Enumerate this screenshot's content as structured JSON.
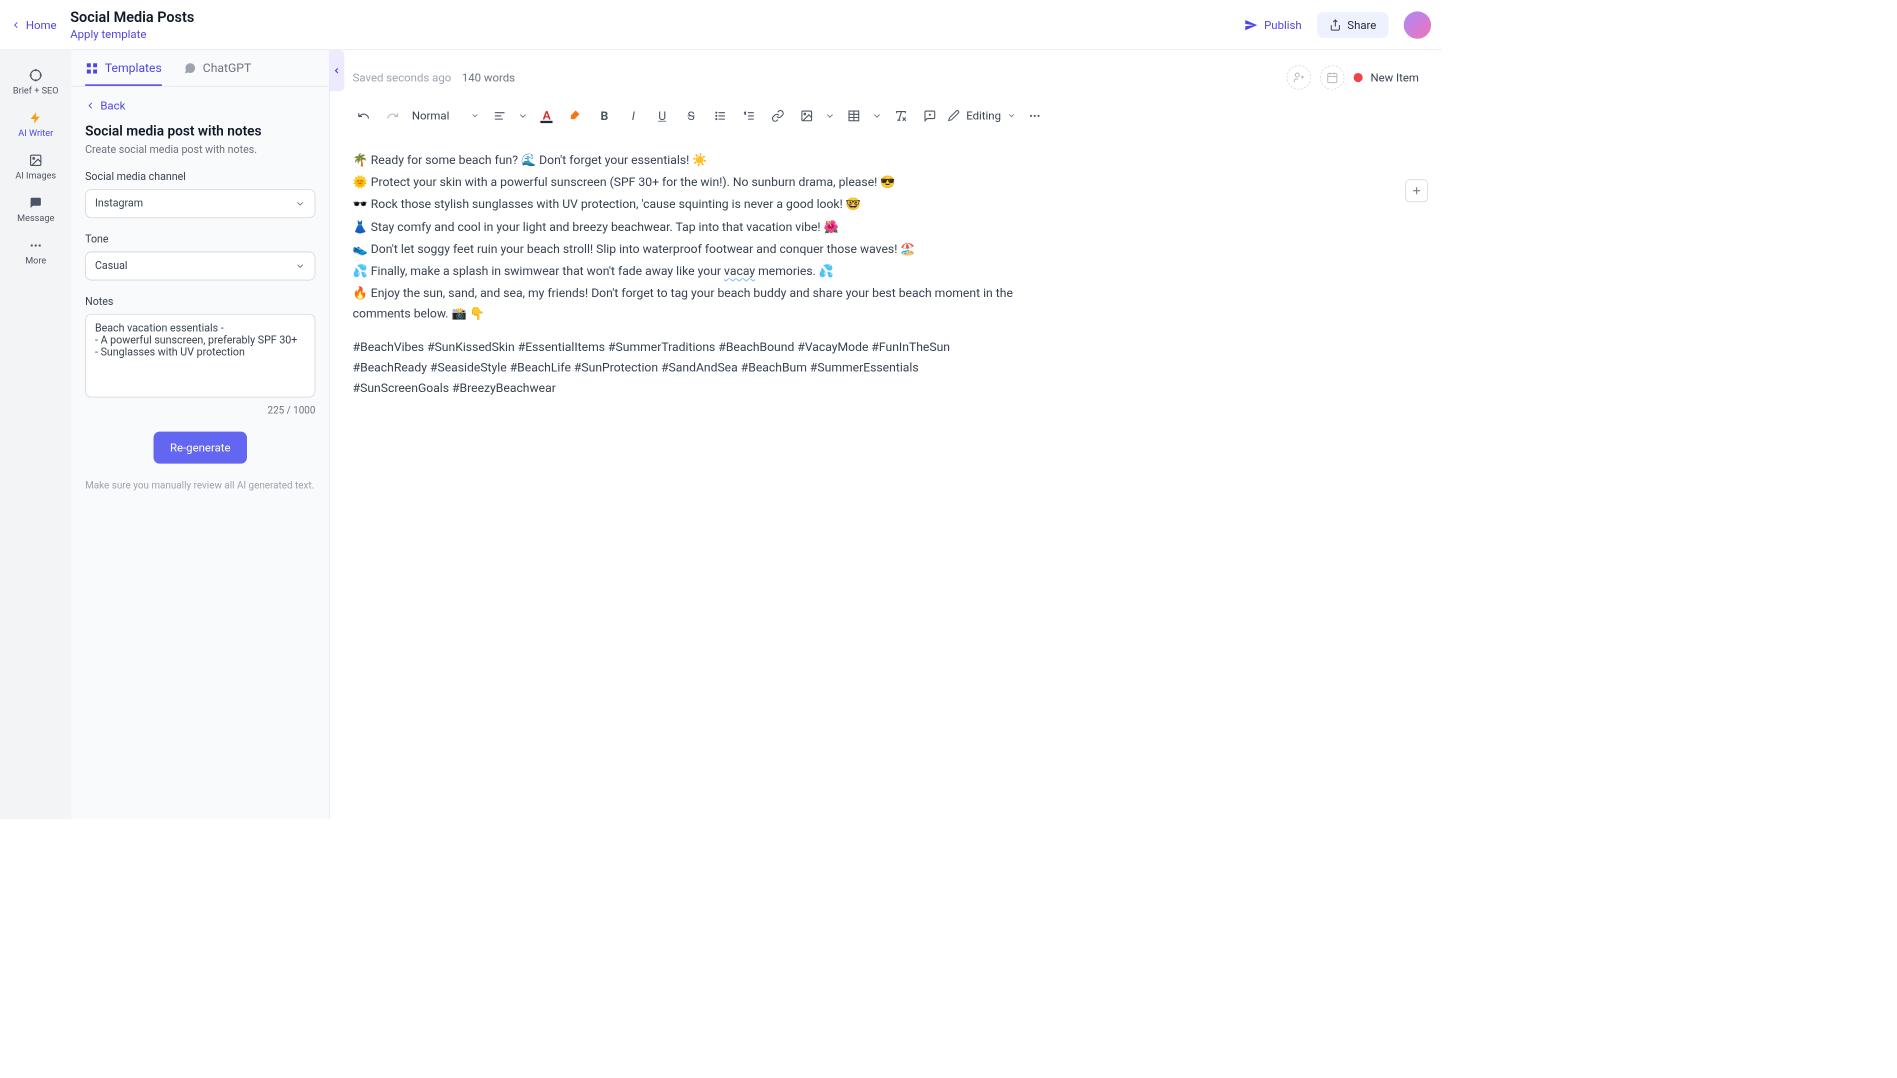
{
  "topbar": {
    "home": "Home",
    "title": "Social Media Posts",
    "apply_template": "Apply template",
    "publish": "Publish",
    "share": "Share"
  },
  "rail": {
    "items": [
      "Brief + SEO",
      "AI Writer",
      "AI Images",
      "Message",
      "More"
    ]
  },
  "tabs": {
    "templates": "Templates",
    "chatgpt": "ChatGPT"
  },
  "panel": {
    "back": "Back",
    "title": "Social media post with notes",
    "desc": "Create social media post with notes.",
    "channel_label": "Social media channel",
    "channel_value": "Instagram",
    "tone_label": "Tone",
    "tone_value": "Casual",
    "notes_label": "Notes",
    "notes_value": "Beach vacation essentials -\n- A powerful sunscreen, preferably SPF 30+\n- Sunglasses with UV protection",
    "char_count": "225 / 1000",
    "regenerate": "Re-generate",
    "review_note": "Make sure you manually review all AI generated text."
  },
  "meta": {
    "saved": "Saved seconds ago",
    "word_count": "140 words",
    "new_item": "New Item"
  },
  "toolbar": {
    "style_select": "Normal",
    "editing": "Editing"
  },
  "doc": {
    "p1": "🌴 Ready for some beach fun? 🌊 Don't forget your essentials! ☀️",
    "p2": "🌞 Protect your skin with a powerful sunscreen (SPF 30+ for the win!). No sunburn drama, please! 😎",
    "p3": "🕶️ Rock those stylish sunglasses with UV protection, 'cause squinting is never a good look! 🤓",
    "p4": "👗 Stay comfy and cool in your light and breezy beachwear. Tap into that vacation vibe! 🌺",
    "p5": "👟 Don't let soggy feet ruin your beach stroll! Slip into waterproof footwear and conquer those waves! 🏖️",
    "p6a": "💦 Finally, make a splash in swimwear that won't fade away like your ",
    "p6_spell": "vacay",
    "p6b": " memories. 💦",
    "p7": "🔥 Enjoy the sun, sand, and sea, my friends! Don't forget to tag your beach buddy and share your best beach moment in the comments below. 📸 👇",
    "hashtags": "#BeachVibes #SunKissedSkin #EssentialItems #SummerTraditions #BeachBound #VacayMode #FunInTheSun #BeachReady #SeasideStyle #BeachLife #SunProtection #SandAndSea #BeachBum #SummerEssentials #SunScreenGoals #BreezyBeachwear"
  }
}
